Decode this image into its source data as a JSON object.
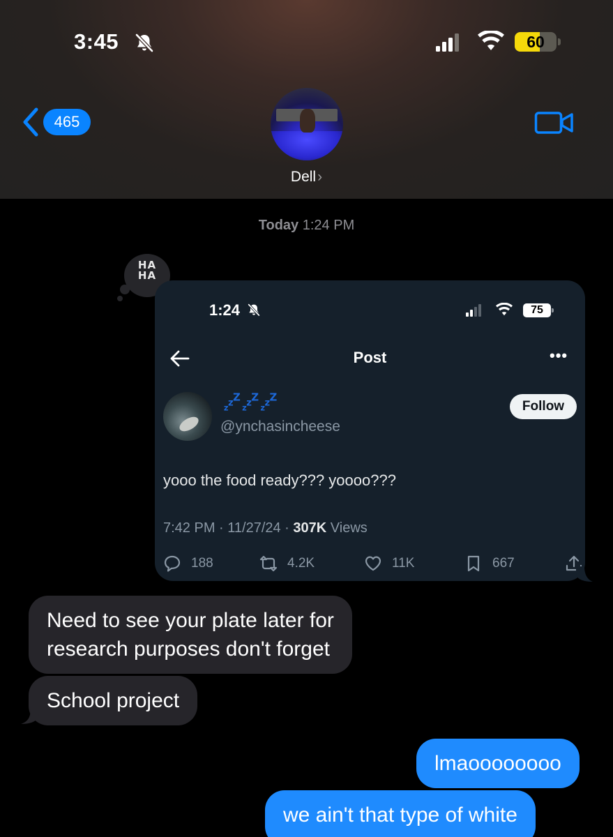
{
  "status_bar": {
    "time": "3:45",
    "battery": "60",
    "battery_level": 0.6,
    "signal_bars_active": 3,
    "signal_bars_total": 4
  },
  "nav": {
    "back_count": "465",
    "contact_name": "Dell",
    "contact_chevron": "›"
  },
  "conversation": {
    "timestamp_day": "Today",
    "timestamp_time": "1:24 PM",
    "tapback": {
      "line1": "HA",
      "line2": "HA"
    },
    "shared_screenshot": {
      "status_time": "1:24",
      "status_battery": "75",
      "title": "Post",
      "more": "•••",
      "display_name": "ᶻᶻᶻᶻ",
      "handle": "@ynchasincheese",
      "follow_label": "Follow",
      "tweet_text": "yooo the food ready??? yoooo???",
      "meta_time": "7:42 PM · 11/27/24 · ",
      "views_count": "307K",
      "views_label": " Views",
      "replies": "188",
      "reposts": "4.2K",
      "likes": "11K",
      "bookmarks": "667"
    },
    "messages": [
      {
        "direction": "incoming",
        "text_line1": "Need to see your plate later for",
        "text_line2": "research purposes don't forget"
      },
      {
        "direction": "incoming",
        "text": "School project"
      },
      {
        "direction": "outgoing",
        "text": "lmaoooooooo"
      },
      {
        "direction": "outgoing",
        "text": "we ain't that type of white"
      }
    ]
  },
  "colors": {
    "imessage_blue": "#1f8bfe",
    "incoming_bubble": "#26252a",
    "twitter_bg": "#15202b",
    "link_blue": "#0a84ff",
    "battery_yellow": "#f5d90a"
  },
  "icons": [
    "bell-slash-icon",
    "signal-icon",
    "wifi-icon",
    "battery-icon",
    "back-chevron-icon",
    "video-camera-icon",
    "arrow-left-icon",
    "reply-icon",
    "repost-icon",
    "heart-icon",
    "bookmark-icon",
    "share-icon"
  ]
}
